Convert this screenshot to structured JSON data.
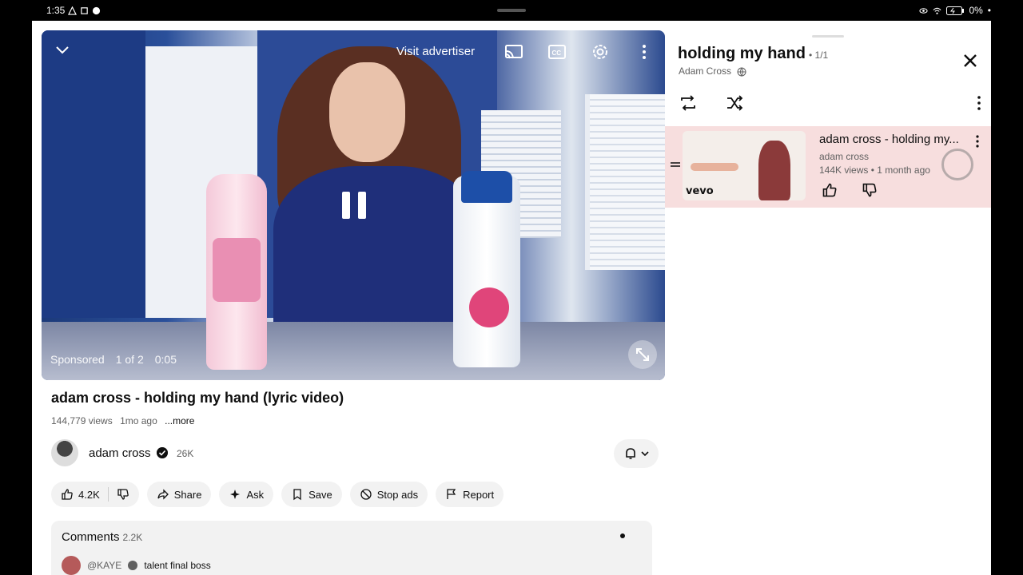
{
  "status_bar": {
    "time": "1:35",
    "battery": "0%"
  },
  "player": {
    "visit_advertiser": "Visit advertiser",
    "ad_label": "Sponsored",
    "ad_position": "1 of 2",
    "ad_time": "0:05"
  },
  "video": {
    "title": "adam cross - holding my hand (lyric video)",
    "views": "144,779 views",
    "age": "1mo ago",
    "more": "...more"
  },
  "channel": {
    "name": "adam cross",
    "subscribers": "26K"
  },
  "actions": {
    "likes": "4.2K",
    "share": "Share",
    "ask": "Ask",
    "save": "Save",
    "stop_ads": "Stop ads",
    "report": "Report"
  },
  "comments": {
    "title": "Comments",
    "count": "2.2K",
    "top_user": "@KAYE",
    "top_text": "talent final boss"
  },
  "playlist": {
    "title": "holding my hand",
    "count": "• 1/1",
    "owner": "Adam Cross",
    "items": [
      {
        "title": "adam cross - holding my...",
        "channel": "adam cross",
        "meta": "144K views • 1 month ago",
        "thumb_brand": "vevo"
      }
    ]
  }
}
